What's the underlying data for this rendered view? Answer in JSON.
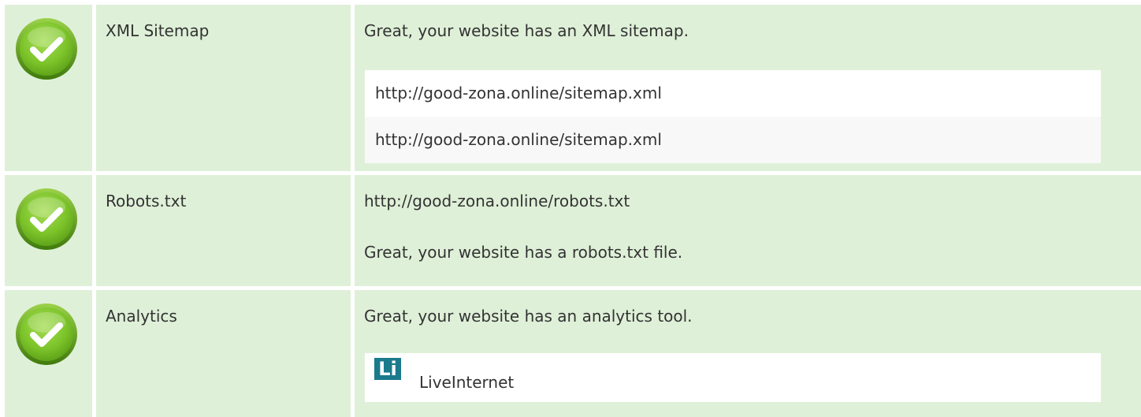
{
  "rows": [
    {
      "label": "XML Sitemap",
      "status_icon": "check-circle-icon",
      "message": "Great, your website has an XML sitemap.",
      "urls": [
        "http://good-zona.online/sitemap.xml",
        "http://good-zona.online/sitemap.xml"
      ]
    },
    {
      "label": "Robots.txt",
      "status_icon": "check-circle-icon",
      "url": "http://good-zona.online/robots.txt",
      "message": "Great, your website has a robots.txt file."
    },
    {
      "label": "Analytics",
      "status_icon": "check-circle-icon",
      "message": "Great, your website has an analytics tool.",
      "tools": [
        {
          "logo_text": "Li",
          "name": "LiveInternet",
          "logo_color": "#1b7a8c"
        }
      ]
    }
  ],
  "colors": {
    "row_background": "#dff0d8",
    "check_green": "#7cc42a",
    "text": "#333333"
  }
}
